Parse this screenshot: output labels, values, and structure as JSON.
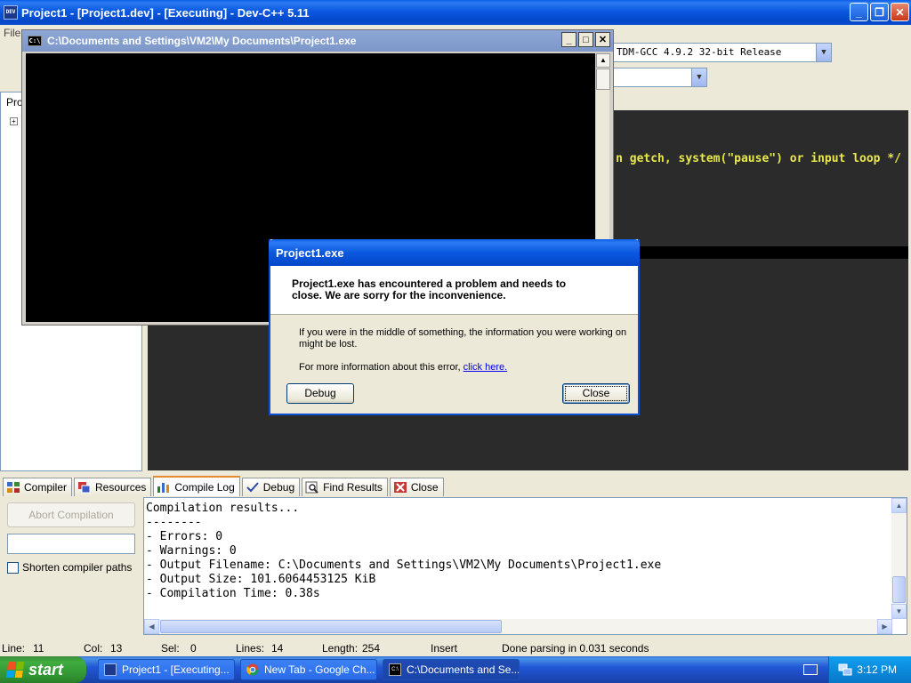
{
  "main_window": {
    "title": "Project1 - [Project1.dev] - [Executing] - Dev-C++ 5.11",
    "menu_first": "File",
    "compiler_combo": "TDM-GCC 4.9.2 32-bit Release",
    "project_tab": "Pro",
    "code_visible": "n getch, system(\"pause\") or input loop */"
  },
  "console": {
    "title": "C:\\Documents and Settings\\VM2\\My Documents\\Project1.exe"
  },
  "error_dialog": {
    "title": "Project1.exe",
    "message": "Project1.exe has encountered a problem and needs to close.  We are sorry for the inconvenience.",
    "info_line": "If you were in the middle of something, the information you were working on might be lost.",
    "more_info": "For more information about this error, ",
    "link_text": "click here.",
    "debug_button": "Debug",
    "close_button": "Close"
  },
  "bottom_tabs": [
    {
      "label": "Compiler"
    },
    {
      "label": "Resources"
    },
    {
      "label": "Compile Log"
    },
    {
      "label": "Debug"
    },
    {
      "label": "Find Results"
    },
    {
      "label": "Close"
    }
  ],
  "compile_panel": {
    "abort_button": "Abort Compilation",
    "shorten_paths_label": "Shorten compiler paths",
    "log_lines": [
      "Compilation results...",
      "--------",
      "- Errors: 0",
      "- Warnings: 0",
      "- Output Filename: C:\\Documents and Settings\\VM2\\My Documents\\Project1.exe",
      "- Output Size: 101.6064453125 KiB",
      "- Compilation Time: 0.38s"
    ]
  },
  "status_bar": {
    "line_label": "Line:",
    "line_value": "11",
    "col_label": "Col:",
    "col_value": "13",
    "sel_label": "Sel:",
    "sel_value": "0",
    "lines_label": "Lines:",
    "lines_value": "14",
    "length_label": "Length:",
    "length_value": "254",
    "mode": "Insert",
    "parse_msg": "Done parsing in 0.031 seconds"
  },
  "taskbar": {
    "start_label": "start",
    "items": [
      {
        "label": "Project1 - [Executing..."
      },
      {
        "label": "New Tab - Google Ch..."
      },
      {
        "label": "C:\\Documents and Se..."
      }
    ],
    "clock": "3:12 PM"
  },
  "colors": {
    "xp_blue": "#0a58e0",
    "editor_bg": "#2b2b2b",
    "code_yellow": "#e8e84a",
    "start_green": "#3fae3f"
  }
}
